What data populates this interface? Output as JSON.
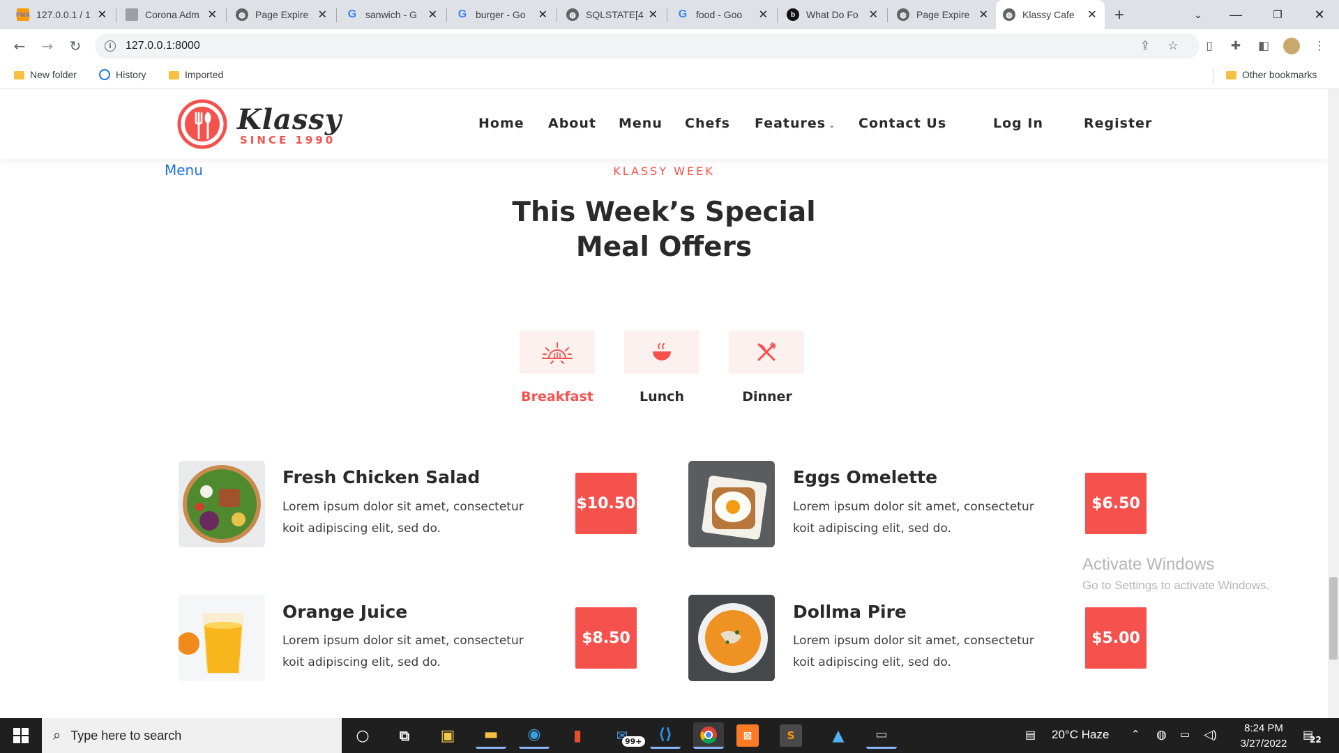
{
  "browser": {
    "tabs": [
      {
        "label": "127.0.0.1 / 1",
        "icon": "phpmyadmin-icon"
      },
      {
        "label": "Corona Adm",
        "icon": "page-icon"
      },
      {
        "label": "Page Expire",
        "icon": "globe-icon"
      },
      {
        "label": "sanwich - G",
        "icon": "google-icon"
      },
      {
        "label": "burger - Go",
        "icon": "google-icon"
      },
      {
        "label": "SQLSTATE[4",
        "icon": "globe-icon"
      },
      {
        "label": "food - Goo",
        "icon": "google-icon"
      },
      {
        "label": "What Do Fo",
        "icon": "app-icon"
      },
      {
        "label": "Page Expire",
        "icon": "globe-icon"
      },
      {
        "label": "Klassy Cafe",
        "icon": "globe-icon",
        "active": true
      }
    ],
    "url": "127.0.0.1:8000",
    "bookmarks": [
      {
        "label": "New folder",
        "icon": "folder-icon"
      },
      {
        "label": "History",
        "icon": "history-icon"
      },
      {
        "label": "Imported",
        "icon": "folder-icon"
      }
    ],
    "other_bookmarks": "Other bookmarks"
  },
  "site": {
    "logo_text": "Klassy",
    "logo_sub": "SINCE 1990",
    "nav": [
      "Home",
      "About",
      "Menu",
      "Chefs",
      "Features",
      "Contact Us",
      "Log In",
      "Register"
    ],
    "accent": "#f5514d"
  },
  "section": {
    "crumb": "Menu",
    "kicker": "KLASSY WEEK",
    "heading_line1": "This Week’s Special",
    "heading_line2": "Meal Offers"
  },
  "meal_tabs": [
    {
      "label": "Breakfast",
      "icon": "sunrise-icon",
      "active": true
    },
    {
      "label": "Lunch",
      "icon": "bowl-icon"
    },
    {
      "label": "Dinner",
      "icon": "cutlery-icon"
    }
  ],
  "items": [
    {
      "name": "Fresh Chicken Salad",
      "desc": "Lorem ipsum dolor sit amet, consectetur koit adipiscing elit, sed do.",
      "price": "$10.50"
    },
    {
      "name": "Eggs Omelette",
      "desc": "Lorem ipsum dolor sit amet, consectetur koit adipiscing elit, sed do.",
      "price": "$6.50"
    },
    {
      "name": "Orange Juice",
      "desc": "Lorem ipsum dolor sit amet, consectetur koit adipiscing elit, sed do.",
      "price": "$8.50"
    },
    {
      "name": "Dollma Pire",
      "desc": "Lorem ipsum dolor sit amet, consectetur koit adipiscing elit, sed do.",
      "price": "$5.00"
    }
  ],
  "watermark": {
    "line1": "Activate Windows",
    "line2": "Go to Settings to activate Windows."
  },
  "taskbar": {
    "search_placeholder": "Type here to search",
    "mail_badge": "99+",
    "weather": "20°C  Haze",
    "time": "8:24 PM",
    "date": "3/27/2022",
    "notifications": "22"
  }
}
